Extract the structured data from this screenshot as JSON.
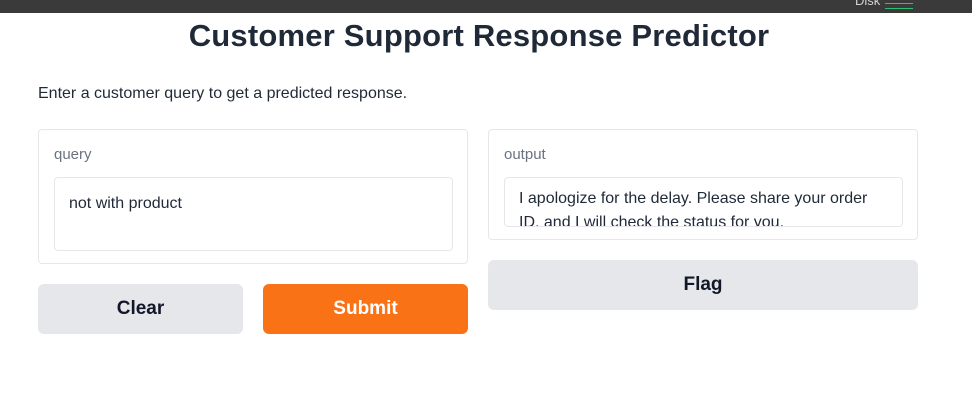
{
  "topbar": {
    "disk_label": "Disk"
  },
  "page": {
    "title": "Customer Support Response Predictor",
    "description": "Enter a customer query to get a predicted response."
  },
  "input_panel": {
    "label": "query",
    "value": "not with product"
  },
  "output_panel": {
    "label": "output",
    "value": "I apologize for the delay. Please share your order ID, and I will check the status for you."
  },
  "buttons": {
    "clear": "Clear",
    "submit": "Submit",
    "flag": "Flag"
  },
  "colors": {
    "primary": "#f97316",
    "secondary": "#e5e7eb",
    "disk_indicator": "#2fbf71"
  }
}
